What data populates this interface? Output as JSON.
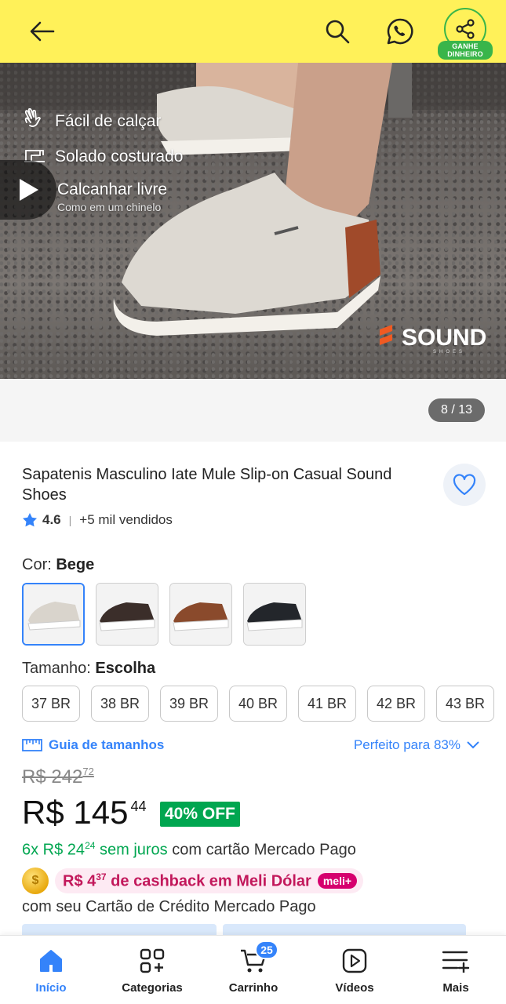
{
  "header": {
    "share_badge": "GANHE DINHEIRO"
  },
  "gallery": {
    "features": [
      {
        "label": "Fácil de calçar"
      },
      {
        "label": "Solado costurado"
      },
      {
        "label": "Calcanhar livre"
      }
    ],
    "feature_sub": "Como em um chinelo",
    "brand": "SOUND",
    "brand_sub": "SHOES",
    "counter": "8 / 13"
  },
  "product": {
    "title": "Sapatenis Masculino Iate Mule Slip-on Casual Sound Shoes",
    "rating": "4.6",
    "sold": "+5 mil vendidos",
    "color_label": "Cor:",
    "color_value": "Bege",
    "colors": [
      {
        "name": "Bege",
        "hex": "#d9d4cc",
        "selected": true
      },
      {
        "name": "Marrom escuro",
        "hex": "#3b2e2a"
      },
      {
        "name": "Caramelo",
        "hex": "#8a4a2c"
      },
      {
        "name": "Preto",
        "hex": "#23262b"
      }
    ],
    "size_label": "Tamanho:",
    "size_value": "Escolha",
    "sizes": [
      "37 BR",
      "38 BR",
      "39 BR",
      "40 BR",
      "41 BR",
      "42 BR",
      "43 BR"
    ],
    "size_guide": "Guia de tamanhos",
    "fit": "Perfeito para 83%",
    "old_price_int": "R$ 242",
    "old_price_cents": "72",
    "price_int": "R$ 145",
    "price_cents": "44",
    "discount": "40% OFF",
    "installments_green": "6x R$ 24",
    "installments_cents": "24",
    "installments_green2": "sem juros",
    "installments_rest": "com cartão Mercado Pago",
    "cashback_prefix": "R$ 4",
    "cashback_cents": "37",
    "cashback_text": "de cashback em Meli Dólar",
    "meli_badge": "meli+",
    "cashback_sub": "com seu Cartão de Crédito Mercado Pago"
  },
  "nav": {
    "items": [
      {
        "label": "Início",
        "icon": "home-icon",
        "active": true
      },
      {
        "label": "Categorias",
        "icon": "categories-icon"
      },
      {
        "label": "Carrinho",
        "icon": "cart-icon",
        "badge": "25"
      },
      {
        "label": "Vídeos",
        "icon": "video-icon"
      },
      {
        "label": "Mais",
        "icon": "more-icon"
      }
    ]
  },
  "colors": {
    "header_bg": "#FFF159",
    "accent_blue": "#3483fa",
    "green": "#00a650",
    "share_green": "#39b54a",
    "cashback_pink": "#c2185b"
  }
}
